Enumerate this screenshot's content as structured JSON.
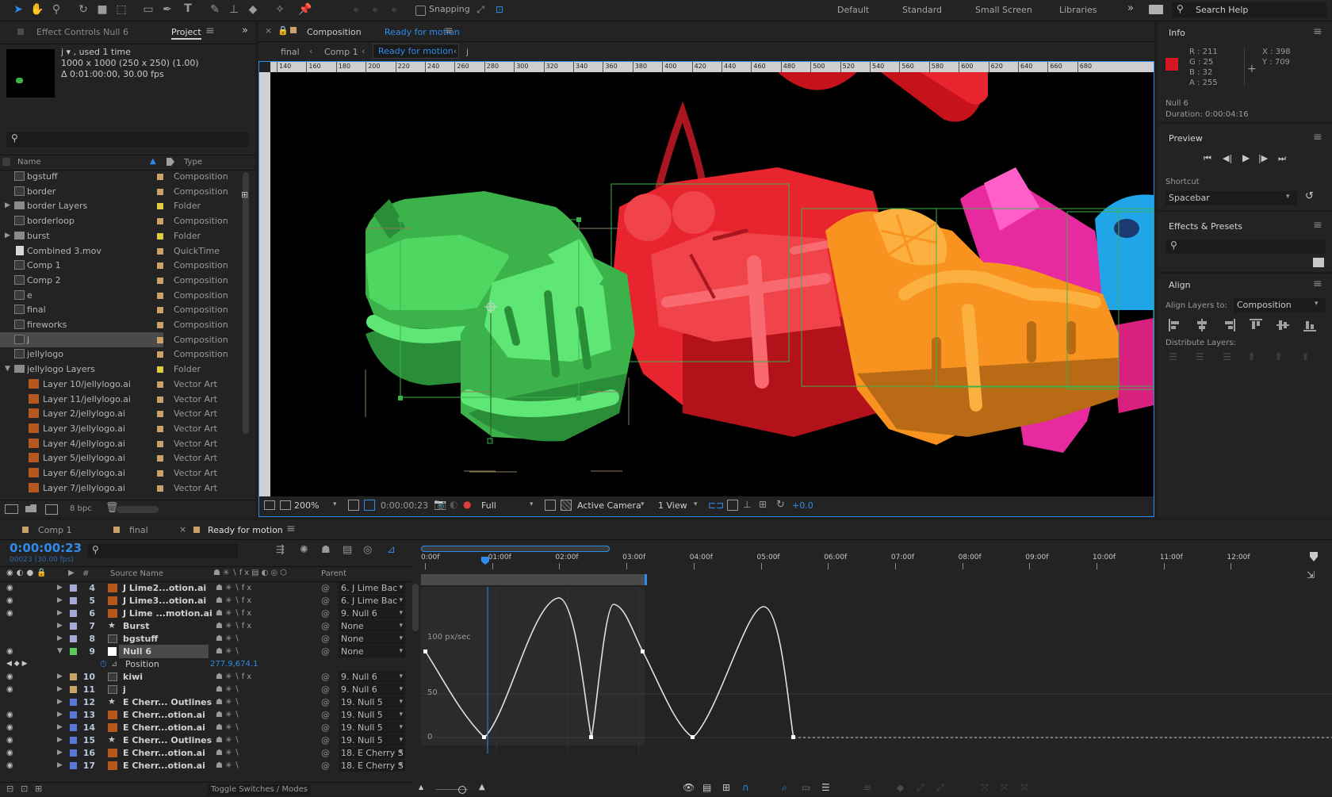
{
  "toolbar": {
    "snapping_label": "Snapping",
    "workspaces": [
      "Default",
      "Standard",
      "Small Screen",
      "Libraries"
    ],
    "search_placeholder": "Search Help"
  },
  "project_panel": {
    "tab_effect_controls": "Effect Controls Null 6",
    "tab_project": "Project",
    "preview_name": "j ▾ , used 1 time",
    "preview_dims": "1000 x 1000  (250 x 250) (1.00)",
    "preview_duration": "Δ 0:01:00:00, 30.00 fps",
    "col_name": "Name",
    "col_type": "Type",
    "items": [
      {
        "name": "bgstuff",
        "type": "Composition",
        "color": "#c9a36a",
        "kind": "comp"
      },
      {
        "name": "border",
        "type": "Composition",
        "color": "#c9a36a",
        "kind": "comp"
      },
      {
        "name": "border Layers",
        "type": "Folder",
        "color": "#e0cc43",
        "kind": "folder"
      },
      {
        "name": "borderloop",
        "type": "Composition",
        "color": "#c9a36a",
        "kind": "comp"
      },
      {
        "name": "burst",
        "type": "Folder",
        "color": "#e0cc43",
        "kind": "folder"
      },
      {
        "name": "Combined 3.mov",
        "type": "QuickTime",
        "color": "#c9a36a",
        "kind": "file"
      },
      {
        "name": "Comp 1",
        "type": "Composition",
        "color": "#c9a36a",
        "kind": "comp"
      },
      {
        "name": "Comp 2",
        "type": "Composition",
        "color": "#c9a36a",
        "kind": "comp"
      },
      {
        "name": "e",
        "type": "Composition",
        "color": "#c9a36a",
        "kind": "comp"
      },
      {
        "name": "final",
        "type": "Composition",
        "color": "#c9a36a",
        "kind": "comp"
      },
      {
        "name": "fireworks",
        "type": "Composition",
        "color": "#c9a36a",
        "kind": "comp"
      },
      {
        "name": "j",
        "type": "Composition",
        "color": "#c9a36a",
        "kind": "comp"
      },
      {
        "name": "jellylogo",
        "type": "Composition",
        "color": "#c9a36a",
        "kind": "comp"
      },
      {
        "name": "jellylogo Layers",
        "type": "Folder",
        "color": "#e0cc43",
        "kind": "folder"
      },
      {
        "name": "Layer 10/jellylogo.ai",
        "type": "Vector Art",
        "color": "#c9a36a",
        "kind": "ai"
      },
      {
        "name": "Layer 11/jellylogo.ai",
        "type": "Vector Art",
        "color": "#c9a36a",
        "kind": "ai"
      },
      {
        "name": "Layer 2/jellylogo.ai",
        "type": "Vector Art",
        "color": "#c9a36a",
        "kind": "ai"
      },
      {
        "name": "Layer 3/jellylogo.ai",
        "type": "Vector Art",
        "color": "#c9a36a",
        "kind": "ai"
      },
      {
        "name": "Layer 4/jellylogo.ai",
        "type": "Vector Art",
        "color": "#c9a36a",
        "kind": "ai"
      },
      {
        "name": "Layer 5/jellylogo.ai",
        "type": "Vector Art",
        "color": "#c9a36a",
        "kind": "ai"
      },
      {
        "name": "Layer 6/jellylogo.ai",
        "type": "Vector Art",
        "color": "#c9a36a",
        "kind": "ai"
      },
      {
        "name": "Layer 7/jellylogo.ai",
        "type": "Vector Art",
        "color": "#c9a36a",
        "kind": "ai"
      }
    ],
    "bpc": "8 bpc"
  },
  "composition": {
    "title_prefix": "Composition",
    "title_name": "Ready for motion",
    "crumbs": [
      "final",
      "Comp 1",
      "Ready for motion",
      "j"
    ],
    "ruler": [
      "140",
      "160",
      "180",
      "200",
      "220",
      "240",
      "260",
      "280",
      "300",
      "320",
      "340",
      "360",
      "380",
      "400",
      "420",
      "440",
      "460",
      "480",
      "500",
      "520",
      "540",
      "560",
      "580",
      "600",
      "620",
      "640",
      "660",
      "680"
    ],
    "zoom": "200%",
    "timecode": "0:00:00:23",
    "resolution": "Full",
    "camera": "Active Camera",
    "views": "1 View",
    "exposure": "+0.0"
  },
  "info": {
    "title": "Info",
    "r": "R : 211",
    "g": "G : 25",
    "b": "B : 32",
    "a": "A :  255",
    "x": "X : 398",
    "y": "Y : 709",
    "swatch": "#d31920",
    "layer": "Null 6",
    "duration": "Duration: 0:00:04:16"
  },
  "preview": {
    "title": "Preview"
  },
  "shortcut": {
    "label": "Shortcut",
    "value": "Spacebar"
  },
  "effects": {
    "title": "Effects & Presets"
  },
  "align": {
    "title": "Align",
    "align_to_label": "Align Layers to:",
    "align_to_value": "Composition",
    "distribute_label": "Distribute Layers:"
  },
  "timeline": {
    "tabs": [
      "Comp 1",
      "final",
      "Ready for motion"
    ],
    "timecode": "0:00:00:23",
    "frames": "00023 (30.00 fps)",
    "col_source": "Source Name",
    "col_parent": "Parent",
    "ruler": [
      "0:00f",
      "01:00f",
      "02:00f",
      "03:00f",
      "04:00f",
      "05:00f",
      "06:00f",
      "07:00f",
      "08:00f",
      "09:00f",
      "10:00f",
      "11:00f",
      "12:00f"
    ],
    "graph_labels": [
      "100 px/sec",
      "50",
      "0"
    ],
    "property_name": "Position",
    "property_value": "277.9,674.1",
    "toggle_label": "Toggle Switches / Modes",
    "layers": [
      {
        "num": "4",
        "name": "J Lime2...otion.ai",
        "color": "#a9a9d8",
        "icon": "ai",
        "parent": "6. J Lime Bac",
        "eye": true,
        "fx": true
      },
      {
        "num": "5",
        "name": "J Lime3...otion.ai",
        "color": "#a9a9d8",
        "icon": "ai",
        "parent": "6. J Lime Bac",
        "eye": true,
        "fx": true
      },
      {
        "num": "6",
        "name": "J Lime ...motion.ai",
        "color": "#a9a9d8",
        "icon": "ai",
        "parent": "9. Null 6",
        "eye": true,
        "fx": true
      },
      {
        "num": "7",
        "name": "Burst",
        "color": "#a9a9d8",
        "icon": "star",
        "parent": "None",
        "eye": false,
        "fx": true
      },
      {
        "num": "8",
        "name": "bgstuff",
        "color": "#a9a9d8",
        "icon": "comp",
        "parent": "None",
        "eye": false,
        "fx": false
      },
      {
        "num": "9",
        "name": "Null 6",
        "color": "#5ac85a",
        "icon": "null",
        "parent": "None",
        "eye": true,
        "fx": false,
        "selected": true
      },
      {
        "num": "10",
        "name": "kiwi",
        "color": "#c9a36a",
        "icon": "comp",
        "parent": "9. Null 6",
        "eye": true,
        "fx": true
      },
      {
        "num": "11",
        "name": "j",
        "color": "#c9a36a",
        "icon": "comp",
        "parent": "9. Null 6",
        "eye": true,
        "fx": false
      },
      {
        "num": "12",
        "name": "E Cherr... Outlines",
        "color": "#5b76d8",
        "icon": "star",
        "parent": "19. Null 5",
        "eye": false,
        "fx": false
      },
      {
        "num": "13",
        "name": "E Cherr...otion.ai",
        "color": "#5b76d8",
        "icon": "ai",
        "parent": "19. Null 5",
        "eye": true,
        "fx": false
      },
      {
        "num": "14",
        "name": "E Cherr...otion.ai",
        "color": "#5b76d8",
        "icon": "ai",
        "parent": "19. Null 5",
        "eye": true,
        "fx": false
      },
      {
        "num": "15",
        "name": "E Cherr... Outlines",
        "color": "#5b76d8",
        "icon": "star",
        "parent": "19. Null 5",
        "eye": true,
        "fx": false
      },
      {
        "num": "16",
        "name": "E Cherr...otion.ai",
        "color": "#5b76d8",
        "icon": "ai",
        "parent": "18. E Cherry S",
        "eye": true,
        "fx": false
      },
      {
        "num": "17",
        "name": "E Cherr...otion.ai",
        "color": "#5b76d8",
        "icon": "ai",
        "parent": "18. E Cherry S",
        "eye": true,
        "fx": false
      }
    ]
  },
  "colors": {
    "accent": "#2d8ceb",
    "panel": "#232323",
    "bg": "#1d1d1d"
  }
}
